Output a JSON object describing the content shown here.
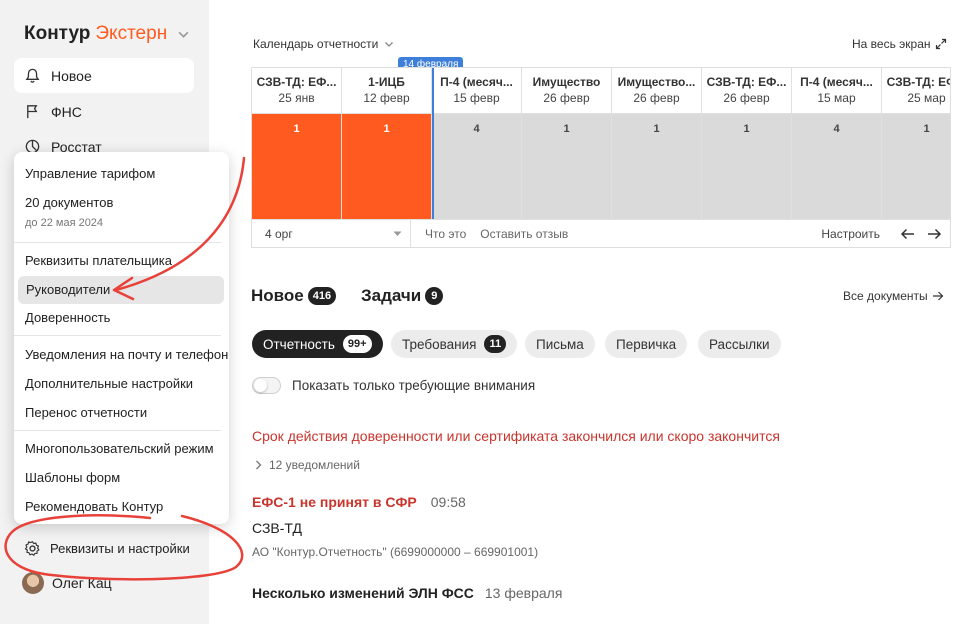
{
  "app": {
    "brand": "Контур",
    "product": "Экстерн"
  },
  "sidebar": {
    "items": [
      {
        "label": "Новое",
        "icon": "bell-icon"
      },
      {
        "label": "ФНС",
        "icon": "flag-icon"
      },
      {
        "label": "Росстат",
        "icon": "chart-icon"
      }
    ],
    "user": "Олег Кац"
  },
  "menu": {
    "tariff": "Управление тарифом",
    "docs_count": "20 документов",
    "docs_until": "до 22 мая 2024",
    "payer_details": "Реквизиты плательщика",
    "managers": "Руководители",
    "power_of_attorney": "Доверенность",
    "notifications": "Уведомления на почту и телефон",
    "extra_settings": "Дополнительные настройки",
    "transfer_reports": "Перенос отчетности",
    "multiuser": "Многопользовательский режим",
    "form_templates": "Шаблоны форм",
    "recommend": "Рекомендовать Контур",
    "settings": "Реквизиты и настройки"
  },
  "calendar": {
    "title": "Календарь отчетности",
    "fullscreen": "На весь экран",
    "today_badge": "14 февраля",
    "columns": [
      {
        "name": "СЗВ-ТД: ЕФ...",
        "date": "25 янв",
        "count": "1",
        "overdue": true
      },
      {
        "name": "1-ИЦБ",
        "date": "12 февр",
        "count": "1",
        "overdue": true
      },
      {
        "name": "П-4 (месяч...",
        "date": "15 февр",
        "count": "4",
        "overdue": false
      },
      {
        "name": "Имущество",
        "date": "26 февр",
        "count": "1",
        "overdue": false
      },
      {
        "name": "Имущество...",
        "date": "26 февр",
        "count": "1",
        "overdue": false
      },
      {
        "name": "СЗВ-ТД: ЕФ...",
        "date": "26 февр",
        "count": "1",
        "overdue": false
      },
      {
        "name": "П-4 (месяч...",
        "date": "15 мар",
        "count": "4",
        "overdue": false
      },
      {
        "name": "СЗВ-ТД: ЕФ...",
        "date": "25 мар",
        "count": "1",
        "overdue": false
      }
    ],
    "org_select": "4 орг",
    "what_is": "Что это",
    "feedback": "Оставить отзыв",
    "configure": "Настроить"
  },
  "sections": {
    "new_label": "Новое",
    "new_count": "416",
    "tasks_label": "Задачи",
    "tasks_count": "9",
    "all_docs": "Все документы"
  },
  "filters": {
    "reports": "Отчетность",
    "reports_count": "99+",
    "requirements": "Требования",
    "requirements_count": "11",
    "letters": "Письма",
    "primary": "Первичка",
    "mailings": "Рассылки"
  },
  "toggle_label": "Показать только требующие внимания",
  "feed": {
    "warning": "Срок действия доверенности или сертификата закончился или скоро закончится",
    "notifications": "12 уведомлений",
    "efs_title": "ЕФС-1 не принят в СФР",
    "efs_time": "09:58",
    "doc_type": "СЗВ-ТД",
    "org": "АО \"Контур.Отчетность\" (6699000000 – 669901001)",
    "eln_title": "Несколько изменений ЭЛН ФСС",
    "eln_date": "13 февраля"
  },
  "colors": {
    "accent": "#ff5a1f",
    "today": "#3d7fd9",
    "warning": "#c8352d",
    "annotation": "#e8413a"
  }
}
